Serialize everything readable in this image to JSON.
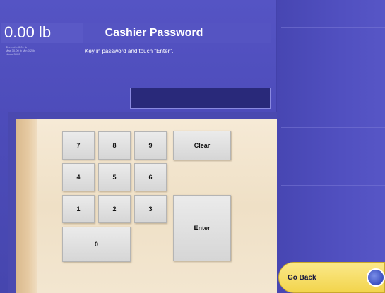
{
  "scale": {
    "weight": "0.00 lb",
    "info_lines": [
      "⊕ e = d = 0.01 lb",
      "Max 30.00 lb Min 0.2 lb",
      "Nmax 3000"
    ]
  },
  "header": {
    "title": "Cashier Password",
    "instruction": "Key in password and touch \"Enter\"."
  },
  "password": {
    "value": ""
  },
  "keypad": {
    "keys": [
      "7",
      "8",
      "9",
      "4",
      "5",
      "6",
      "1",
      "2",
      "3",
      "0"
    ],
    "clear_label": "Clear",
    "enter_label": "Enter"
  },
  "go_back": {
    "label": "Go Back"
  },
  "colors": {
    "background": "#4b4ab4",
    "keypad_background": "#f3e6d0",
    "go_back_button": "#f2d44c"
  }
}
